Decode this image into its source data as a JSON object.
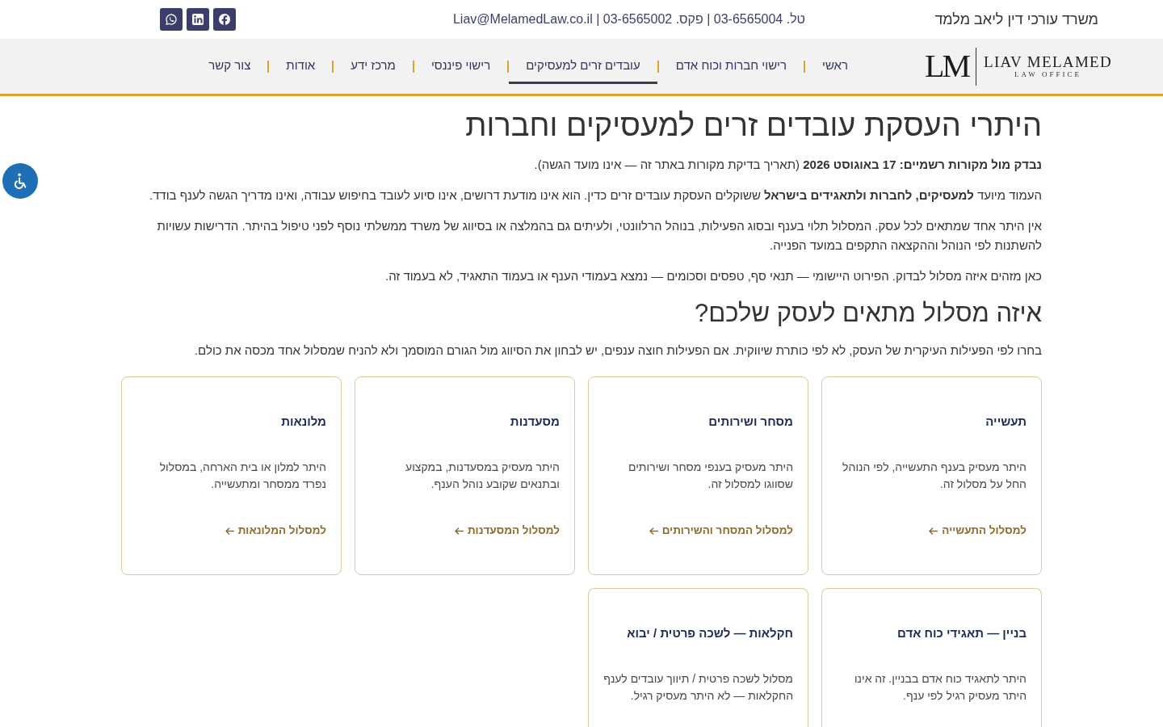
{
  "top_bar": {
    "firm_name": "משרד עורכי דין ליאב מלמד",
    "contact": "טל. 03-6565004 | פקס. 03-6565002 | Liav@MelamedLaw.co.il",
    "social_links": [
      {
        "kind": "facebook"
      },
      {
        "kind": "linkedin"
      },
      {
        "kind": "whatsapp"
      }
    ]
  },
  "header": {
    "logo": {
      "monogram": "LM",
      "name": "LIAV MELAMED",
      "tagline": "LAW OFFICE"
    },
    "nav": [
      {
        "label": "ראשי",
        "selected": false
      },
      {
        "label": "רישוי חברות וכוח אדם",
        "selected": false
      },
      {
        "label": "עובדים זרים למעסיקים",
        "selected": true
      },
      {
        "label": "רישוי פיננסי",
        "selected": false
      },
      {
        "label": "מרכז ידע",
        "selected": false
      },
      {
        "label": "אודות",
        "selected": false
      },
      {
        "label": "צור קשר",
        "selected": false
      }
    ]
  },
  "main": {
    "title": "היתרי העסקת עובדים זרים למעסיקים וחברות",
    "paragraphs": [
      "**נבדק מול מקורות רשמיים: 17 באוגוסט 2026** (תאריך בדיקת מקורות באתר זה — אינו מועד הגשה).",
      "העמוד מיועד **למעסיקים, לחברות ולתאגידים בישראל** ששוקלים העסקת עובדים זרים כדין. הוא אינו מודעת דרושים, אינו סיוע לעובד בחיפוש עבודה, ואינו מדריך הגשה לענף בודד.",
      "אין היתר אחד שמתאים לכל עסק. המסלול תלוי בענף ובסוג הפעילות, בנוהל הרלוונטי, ולעיתים גם בהמלצה או בסיווג של משרד ממשלתי נוסף לפני טיפול בהיתר. הדרישות עשויות להשתנות לפי הנוהל וההקצאה התקפים במועד הפנייה.",
      "כאן מזהים איזה מסלול לבדוק. הפירוט היישומי — תנאי סף, טפסים וסכומים — נמצא בעמודי הענף או בעמוד התאגיד, לא בעמוד זה."
    ],
    "section_title": "איזה מסלול מתאים לעסק שלכם?",
    "section_intro": "בחרו לפי הפעילות העיקרית של העסק, לא לפי כותרת שיווקית. אם הפעילות חוצה ענפים, יש לבחון את הסיווג מול הגורם המוסמך ולא להניח שמסלול אחד מכסה את כולם.",
    "cards": [
      {
        "title": "תעשייה",
        "description": "היתר מעסיק בענף התעשייה, לפי הנוהל החל על מסלול זה.",
        "link": "למסלול התעשייה"
      },
      {
        "title": "מסחר ושירותים",
        "description": "היתר מעסיק בענפי מסחר ושירותים שסווגו למסלול זה.",
        "link": "למסלול המסחר והשירותים"
      },
      {
        "title": "מסעדנות",
        "description": "היתר מעסיק במסעדנות, במקצוע ובתנאים שקובע נוהל הענף.",
        "link": "למסלול המסעדנות"
      },
      {
        "title": "מלונאות",
        "description": "היתר למלון או בית הארחה, במסלול נפרד ממסחר ומתעשייה.",
        "link": "למסלול המלונאות"
      },
      {
        "title": "בניין — תאגידי כוח אדם",
        "description": "היתר לתאגיד כוח אדם בבניין. זה אינו היתר מעסיק רגיל לפי ענף."
      },
      {
        "title": "חקלאות — לשכה פרטית / יבוא",
        "description": "מסלול לשכה פרטית / תיווך עובדים לענף החקלאות — לא היתר מעסיק רגיל."
      }
    ]
  }
}
